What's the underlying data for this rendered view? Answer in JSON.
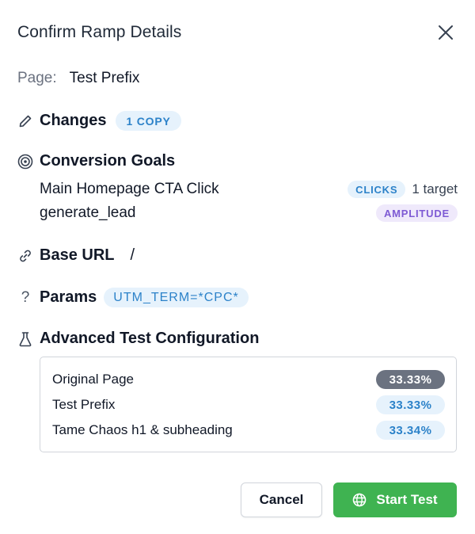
{
  "dialog": {
    "title": "Confirm Ramp Details",
    "close_icon": "close-icon"
  },
  "page": {
    "label": "Page:",
    "value": "Test Prefix"
  },
  "changes": {
    "title": "Changes",
    "icon": "pencil-icon",
    "badge": "1 COPY"
  },
  "conversion_goals": {
    "title": "Conversion Goals",
    "icon": "target-icon",
    "goals": [
      {
        "name": "Main Homepage CTA Click",
        "badge": "CLICKS",
        "badge_color": "#2c82c9",
        "target": "1 target"
      },
      {
        "name": "generate_lead",
        "badge": "AMPLITUDE",
        "badge_color": "#7e5ad4",
        "target": ""
      }
    ]
  },
  "base_url": {
    "title": "Base URL",
    "icon": "link-icon",
    "value": "/"
  },
  "params": {
    "title": "Params",
    "icon": "?",
    "value": "UTM_TERM=*CPC*"
  },
  "advanced_config": {
    "title": "Advanced Test Configuration",
    "icon": "flask-icon",
    "variants": [
      {
        "name": "Original Page",
        "percent": "33.33%",
        "style": "dark"
      },
      {
        "name": "Test Prefix",
        "percent": "33.33%",
        "style": "light"
      },
      {
        "name": "Tame Chaos h1 & subheading",
        "percent": "33.34%",
        "style": "light"
      }
    ]
  },
  "actions": {
    "cancel_label": "Cancel",
    "start_label": "Start Test",
    "start_icon": "globe-icon"
  },
  "colors": {
    "accent_blue": "#2c82c9",
    "accent_purple": "#7e5ad4",
    "start_green": "#3fb351"
  }
}
